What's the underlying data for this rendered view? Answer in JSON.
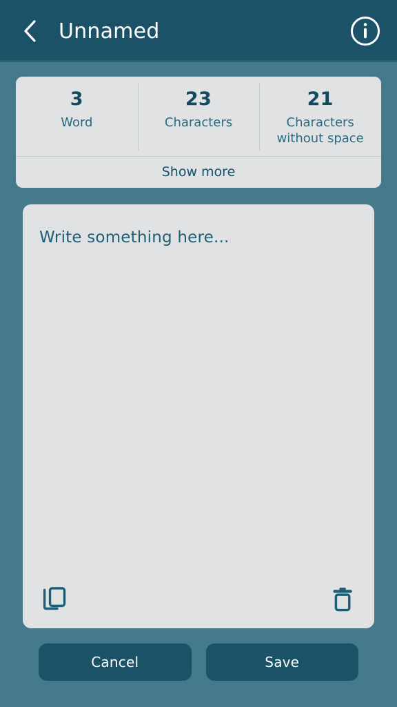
{
  "header": {
    "title": "Unnamed",
    "back_icon": "chevron-left-icon",
    "info_icon": "info-circle-icon"
  },
  "stats": {
    "items": [
      {
        "value": "3",
        "label": "Word"
      },
      {
        "value": "23",
        "label": "Characters"
      },
      {
        "value": "21",
        "label": "Characters without space"
      }
    ],
    "show_more_label": "Show more"
  },
  "editor": {
    "placeholder": "Write something here...",
    "value": "",
    "copy_icon": "copy-icon",
    "delete_icon": "trash-icon"
  },
  "footer": {
    "cancel_label": "Cancel",
    "save_label": "Save"
  },
  "colors": {
    "page_background": "#457a8c",
    "appbar_background": "#1b5267",
    "card_background": "#e0e2e3",
    "accent_text": "#134a5e",
    "muted_text": "#2a6b81",
    "button_background": "#1b5267",
    "button_text": "#ffffff"
  }
}
